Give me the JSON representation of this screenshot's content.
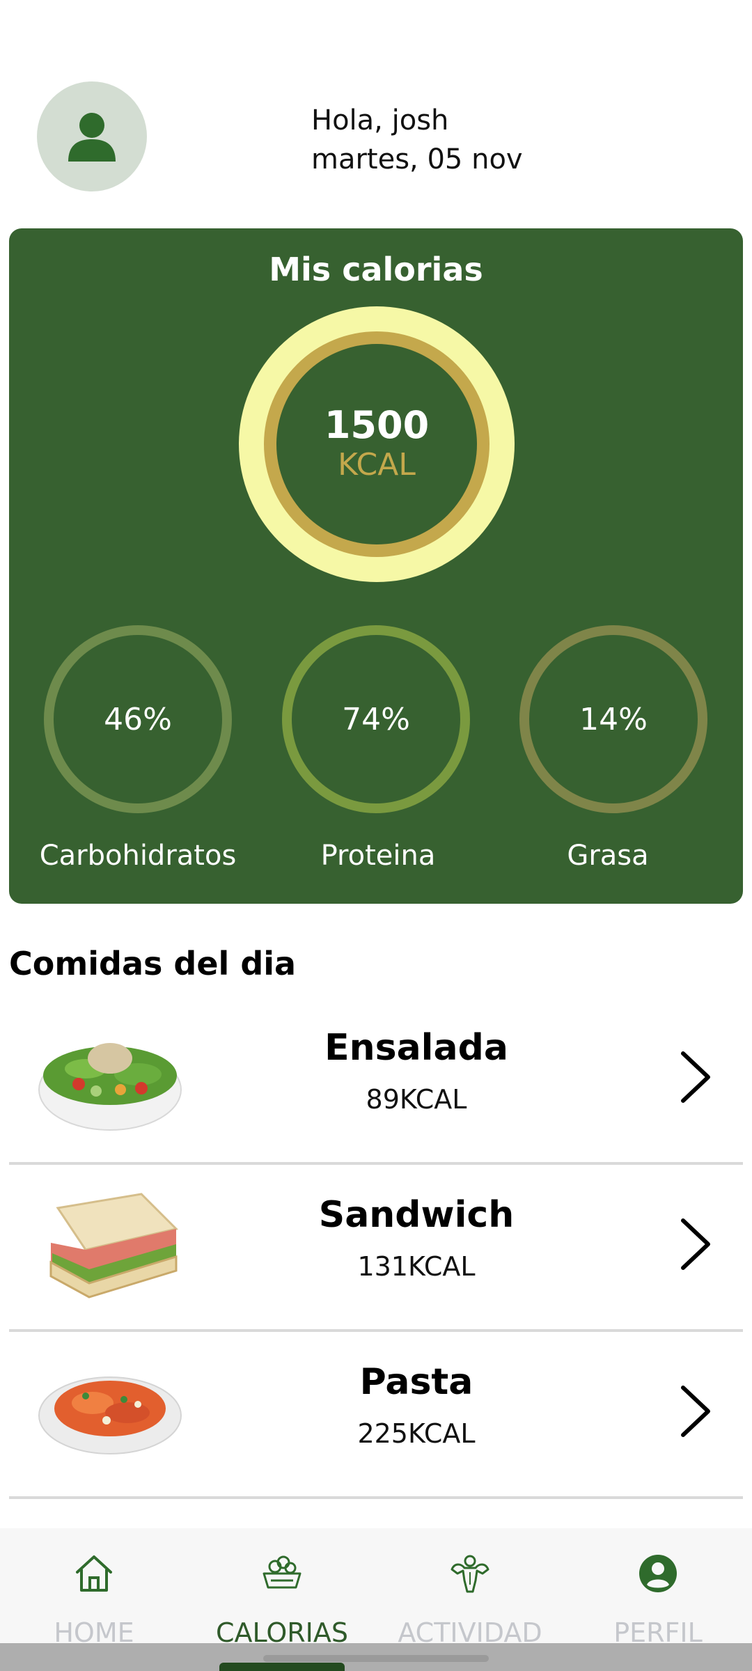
{
  "header": {
    "greeting": "Hola, josh",
    "date": "martes, 05 nov"
  },
  "calories_card": {
    "title": "Mis calorias",
    "value": "1500",
    "unit": "KCAL",
    "macros": [
      {
        "label": "Carbohidratos",
        "percent": "46%"
      },
      {
        "label": "Proteina",
        "percent": "74%"
      },
      {
        "label": "Grasa",
        "percent": "14%"
      }
    ]
  },
  "meals_section": {
    "title": "Comidas del dia",
    "items": [
      {
        "name": "Ensalada",
        "kcal": "89KCAL",
        "image": "salad-image"
      },
      {
        "name": "Sandwich",
        "kcal": "131KCAL",
        "image": "sandwich-image"
      },
      {
        "name": "Pasta",
        "kcal": "225KCAL",
        "image": "pasta-image"
      }
    ]
  },
  "tabbar": {
    "tabs": [
      {
        "label": "HOME",
        "icon": "home-icon"
      },
      {
        "label": "CALORIAS",
        "icon": "bowl-icon",
        "active": true
      },
      {
        "label": "ACTIVIDAD",
        "icon": "muscle-icon"
      },
      {
        "label": "PERFIL",
        "icon": "account-circle-icon"
      }
    ]
  },
  "colors": {
    "primary_green": "#376130",
    "ring_yellow": "#f6f8a6",
    "ring_gold": "#c4a84c"
  }
}
